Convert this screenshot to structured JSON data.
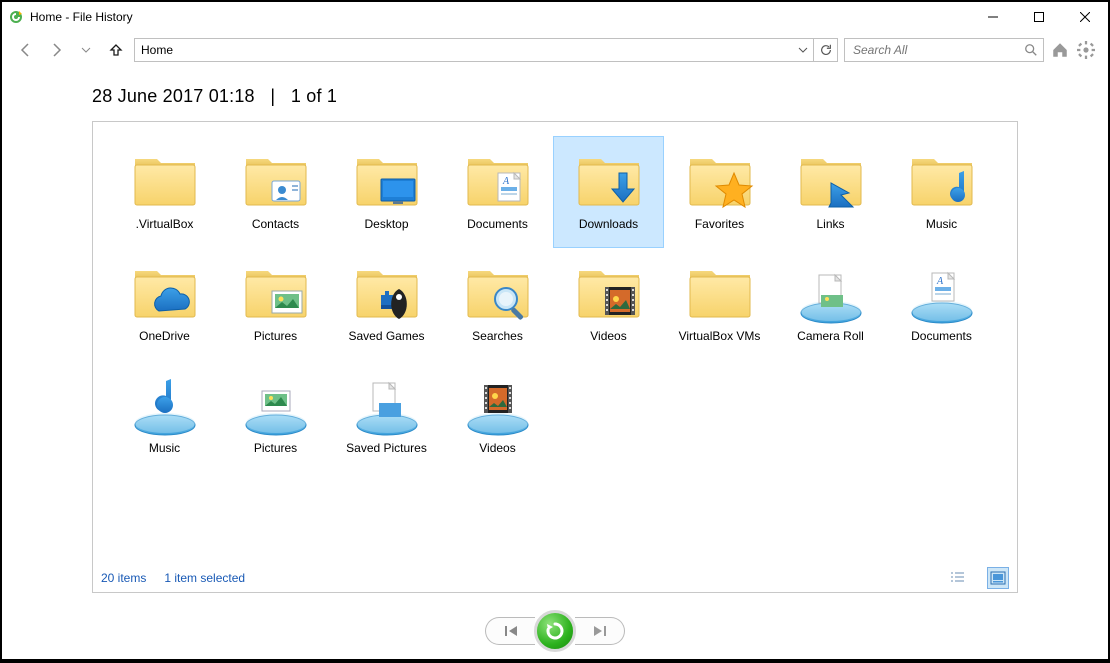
{
  "titlebar": {
    "title": "Home - File History"
  },
  "toolbar": {
    "path": "Home",
    "search_placeholder": "Search All"
  },
  "timestamp": {
    "date": "28 June 2017 01:18",
    "sep": "|",
    "pos": "1 of 1"
  },
  "items": [
    {
      "label": ".VirtualBox",
      "icon": "folder",
      "selected": false
    },
    {
      "label": "Contacts",
      "icon": "folder-contacts",
      "selected": false
    },
    {
      "label": "Desktop",
      "icon": "folder-desktop",
      "selected": false
    },
    {
      "label": "Documents",
      "icon": "folder-docs",
      "selected": false
    },
    {
      "label": "Downloads",
      "icon": "folder-download",
      "selected": true
    },
    {
      "label": "Favorites",
      "icon": "folder-star",
      "selected": false
    },
    {
      "label": "Links",
      "icon": "folder-link",
      "selected": false
    },
    {
      "label": "Music",
      "icon": "folder-music",
      "selected": false
    },
    {
      "label": "OneDrive",
      "icon": "folder-cloud",
      "selected": false
    },
    {
      "label": "Pictures",
      "icon": "folder-pics",
      "selected": false
    },
    {
      "label": "Saved Games",
      "icon": "folder-games",
      "selected": false
    },
    {
      "label": "Searches",
      "icon": "folder-search",
      "selected": false
    },
    {
      "label": "Videos",
      "icon": "folder-video",
      "selected": false
    },
    {
      "label": "VirtualBox VMs",
      "icon": "folder",
      "selected": false
    },
    {
      "label": "Camera Roll",
      "icon": "lib-camera",
      "selected": false
    },
    {
      "label": "Documents",
      "icon": "lib-docs",
      "selected": false
    },
    {
      "label": "Music",
      "icon": "lib-music",
      "selected": false
    },
    {
      "label": "Pictures",
      "icon": "lib-pics",
      "selected": false
    },
    {
      "label": "Saved Pictures",
      "icon": "lib-saved",
      "selected": false
    },
    {
      "label": "Videos",
      "icon": "lib-video",
      "selected": false
    }
  ],
  "status": {
    "count": "20 items",
    "selected": "1 item selected"
  }
}
